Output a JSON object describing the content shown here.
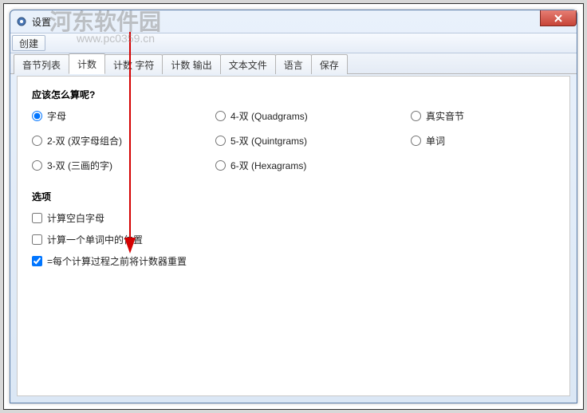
{
  "window": {
    "title": "设置"
  },
  "toolbar": {
    "create": "创建"
  },
  "tabs": {
    "t0": "音节列表",
    "t1": "计数",
    "t2": "计数 字符",
    "t3": "计数 输出",
    "t4": "文本文件",
    "t5": "语言",
    "t6": "保存"
  },
  "section": {
    "how_heading": "应该怎么算呢?",
    "options_heading": "选项"
  },
  "radios": {
    "r1": "字母",
    "r2": "2-双 (双字母组合)",
    "r3": "3-双 (三画的字)",
    "r4": "4-双 (Quadgrams)",
    "r5": "5-双 (Quintgrams)",
    "r6": "6-双 (Hexagrams)",
    "r7": "真实音节",
    "r8": "单词"
  },
  "checks": {
    "c1": "计算空白字母",
    "c2": "计算一个单词中的位置",
    "c3": "=每个计算过程之前将计数器重置"
  },
  "watermark": {
    "brand": "河东软件园",
    "url": "www.pc0359.cn"
  }
}
